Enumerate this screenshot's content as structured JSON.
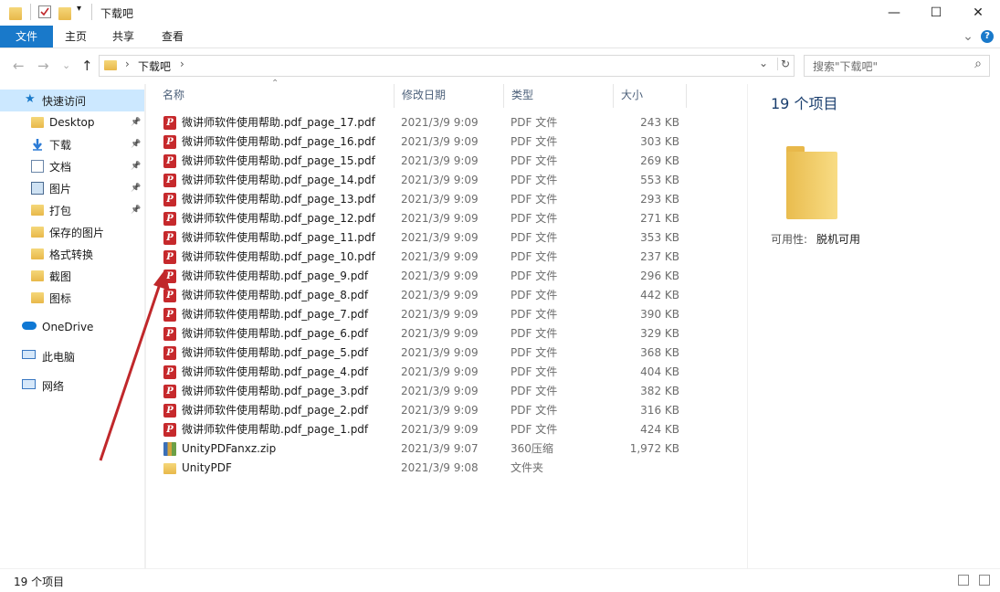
{
  "window": {
    "title": "下载吧",
    "minimize_glyph": "—",
    "maximize_glyph": "☐",
    "close_glyph": "✕"
  },
  "ribbon": {
    "tabs": [
      "文件",
      "主页",
      "共享",
      "查看"
    ],
    "expand_glyph": "⌄",
    "help_glyph": "?"
  },
  "address": {
    "breadcrumb": "下载吧",
    "back_glyph": "←",
    "forward_glyph": "→",
    "recent_glyph": "⌄",
    "up_glyph": "↑",
    "sep_glyph": "›",
    "dropdown_glyph": "⌄",
    "refresh_glyph": "↻",
    "search_placeholder": "搜索\"下载吧\"",
    "search_glyph": "⌕"
  },
  "sidebar": {
    "quick_access": "快速访问",
    "items": [
      {
        "label": "Desktop",
        "icon": "folder-icon",
        "pinned": true
      },
      {
        "label": "下载",
        "icon": "download-arrow-icon",
        "pinned": true
      },
      {
        "label": "文档",
        "icon": "document-icon",
        "pinned": true
      },
      {
        "label": "图片",
        "icon": "pictures-icon",
        "pinned": true
      },
      {
        "label": "打包",
        "icon": "folder-icon",
        "pinned": true
      },
      {
        "label": "保存的图片",
        "icon": "folder-icon",
        "pinned": false
      },
      {
        "label": "格式转换",
        "icon": "folder-icon",
        "pinned": false
      },
      {
        "label": "截图",
        "icon": "folder-icon",
        "pinned": false
      },
      {
        "label": "图标",
        "icon": "folder-icon",
        "pinned": false
      }
    ],
    "onedrive": "OneDrive",
    "this_pc": "此电脑",
    "network": "网络",
    "pin_glyph": "📌"
  },
  "columns": {
    "name": "名称",
    "date": "修改日期",
    "type": "类型",
    "size": "大小",
    "sort_glyph": "⌃"
  },
  "files": [
    {
      "name": "微讲师软件使用帮助.pdf_page_17.pdf",
      "date": "2021/3/9 9:09",
      "type": "PDF 文件",
      "size": "243 KB",
      "icon": "pdf-icon"
    },
    {
      "name": "微讲师软件使用帮助.pdf_page_16.pdf",
      "date": "2021/3/9 9:09",
      "type": "PDF 文件",
      "size": "303 KB",
      "icon": "pdf-icon"
    },
    {
      "name": "微讲师软件使用帮助.pdf_page_15.pdf",
      "date": "2021/3/9 9:09",
      "type": "PDF 文件",
      "size": "269 KB",
      "icon": "pdf-icon"
    },
    {
      "name": "微讲师软件使用帮助.pdf_page_14.pdf",
      "date": "2021/3/9 9:09",
      "type": "PDF 文件",
      "size": "553 KB",
      "icon": "pdf-icon"
    },
    {
      "name": "微讲师软件使用帮助.pdf_page_13.pdf",
      "date": "2021/3/9 9:09",
      "type": "PDF 文件",
      "size": "293 KB",
      "icon": "pdf-icon"
    },
    {
      "name": "微讲师软件使用帮助.pdf_page_12.pdf",
      "date": "2021/3/9 9:09",
      "type": "PDF 文件",
      "size": "271 KB",
      "icon": "pdf-icon"
    },
    {
      "name": "微讲师软件使用帮助.pdf_page_11.pdf",
      "date": "2021/3/9 9:09",
      "type": "PDF 文件",
      "size": "353 KB",
      "icon": "pdf-icon"
    },
    {
      "name": "微讲师软件使用帮助.pdf_page_10.pdf",
      "date": "2021/3/9 9:09",
      "type": "PDF 文件",
      "size": "237 KB",
      "icon": "pdf-icon"
    },
    {
      "name": "微讲师软件使用帮助.pdf_page_9.pdf",
      "date": "2021/3/9 9:09",
      "type": "PDF 文件",
      "size": "296 KB",
      "icon": "pdf-icon"
    },
    {
      "name": "微讲师软件使用帮助.pdf_page_8.pdf",
      "date": "2021/3/9 9:09",
      "type": "PDF 文件",
      "size": "442 KB",
      "icon": "pdf-icon"
    },
    {
      "name": "微讲师软件使用帮助.pdf_page_7.pdf",
      "date": "2021/3/9 9:09",
      "type": "PDF 文件",
      "size": "390 KB",
      "icon": "pdf-icon"
    },
    {
      "name": "微讲师软件使用帮助.pdf_page_6.pdf",
      "date": "2021/3/9 9:09",
      "type": "PDF 文件",
      "size": "329 KB",
      "icon": "pdf-icon"
    },
    {
      "name": "微讲师软件使用帮助.pdf_page_5.pdf",
      "date": "2021/3/9 9:09",
      "type": "PDF 文件",
      "size": "368 KB",
      "icon": "pdf-icon"
    },
    {
      "name": "微讲师软件使用帮助.pdf_page_4.pdf",
      "date": "2021/3/9 9:09",
      "type": "PDF 文件",
      "size": "404 KB",
      "icon": "pdf-icon"
    },
    {
      "name": "微讲师软件使用帮助.pdf_page_3.pdf",
      "date": "2021/3/9 9:09",
      "type": "PDF 文件",
      "size": "382 KB",
      "icon": "pdf-icon"
    },
    {
      "name": "微讲师软件使用帮助.pdf_page_2.pdf",
      "date": "2021/3/9 9:09",
      "type": "PDF 文件",
      "size": "316 KB",
      "icon": "pdf-icon"
    },
    {
      "name": "微讲师软件使用帮助.pdf_page_1.pdf",
      "date": "2021/3/9 9:09",
      "type": "PDF 文件",
      "size": "424 KB",
      "icon": "pdf-icon"
    },
    {
      "name": "UnityPDFanxz.zip",
      "date": "2021/3/9 9:07",
      "type": "360压缩",
      "size": "1,972 KB",
      "icon": "zip-archive-icon"
    },
    {
      "name": "UnityPDF",
      "date": "2021/3/9 9:08",
      "type": "文件夹",
      "size": "",
      "icon": "folder-icon"
    }
  ],
  "detail": {
    "count": "19 个项目",
    "availability_label": "可用性:",
    "availability_value": "脱机可用"
  },
  "status": {
    "count": "19 个项目"
  },
  "colors": {
    "accent": "#1979ca",
    "arrow": "#c0282b",
    "pdf": "#c6292c"
  }
}
